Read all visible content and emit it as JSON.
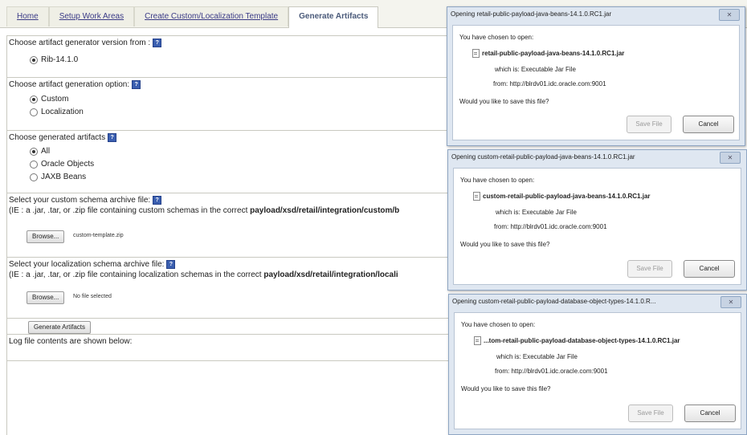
{
  "tabs": [
    "Home",
    "Setup Work Areas",
    "Create Custom/Localization Template",
    "Generate Artifacts"
  ],
  "form": {
    "version_title": "Choose artifact generator version from :",
    "version_option": "Rib-14.1.0",
    "option_title": "Choose artifact generation option:",
    "option_custom": "Custom",
    "option_localization": "Localization",
    "generated_title": "Choose generated artifacts",
    "gen_all": "All",
    "gen_oracle": "Oracle Objects",
    "gen_jaxb": "JAXB Beans",
    "custom_title": "Select your custom schema archive file:",
    "custom_desc_prefix": "(IE : a .jar, .tar, or .zip file containing custom schemas in the correct",
    "custom_desc_path": "payload/xsd/retail/integration/custom/b",
    "browse_label": "Browse...",
    "custom_file": "custom-template.zip",
    "loc_title": "Select your localization schema archive file:",
    "loc_desc_prefix": "(IE : a .jar, .tar, or .zip file containing localization schemas in the correct",
    "loc_desc_path": "payload/xsd/retail/integration/locali",
    "loc_file": "No file selected",
    "generate_label": "Generate Artifacts",
    "log_label": "Log file contents are shown below:"
  },
  "dialogs": [
    {
      "title": "Opening retail-public-payload-java-beans-14.1.0.RC1.jar",
      "chosen": "You have chosen to open:",
      "file": "retail-public-payload-java-beans-14.1.0.RC1.jar",
      "which": "which is:  Executable Jar File",
      "from": "from:  http://blrdv01.idc.oracle.com:9001",
      "question": "Would you like to save this file?",
      "save": "Save File",
      "cancel": "Cancel"
    },
    {
      "title": "Opening custom-retail-public-payload-java-beans-14.1.0.RC1.jar",
      "chosen": "You have chosen to open:",
      "file": "custom-retail-public-payload-java-beans-14.1.0.RC1.jar",
      "which": "which is:  Executable Jar File",
      "from": "from:  http://blrdv01.idc.oracle.com:9001",
      "question": "Would you like to save this file?",
      "save": "Save File",
      "cancel": "Cancel"
    },
    {
      "title": "Opening custom-retail-public-payload-database-object-types-14.1.0.R...",
      "chosen": "You have chosen to open:",
      "file": "...tom-retail-public-payload-database-object-types-14.1.0.RC1.jar",
      "which": "which is:  Executable Jar File",
      "from": "from:  http://blrdv01.idc.oracle.com:9001",
      "question": "Would you like to save this file?",
      "save": "Save File",
      "cancel": "Cancel"
    }
  ],
  "icons": {
    "help": "help-icon",
    "close": "close-icon",
    "file": "file-icon"
  },
  "colors": {
    "link": "#3a3a86",
    "help_icon": "#3b5fb0",
    "dialog_frame": "#dfe7f1"
  }
}
